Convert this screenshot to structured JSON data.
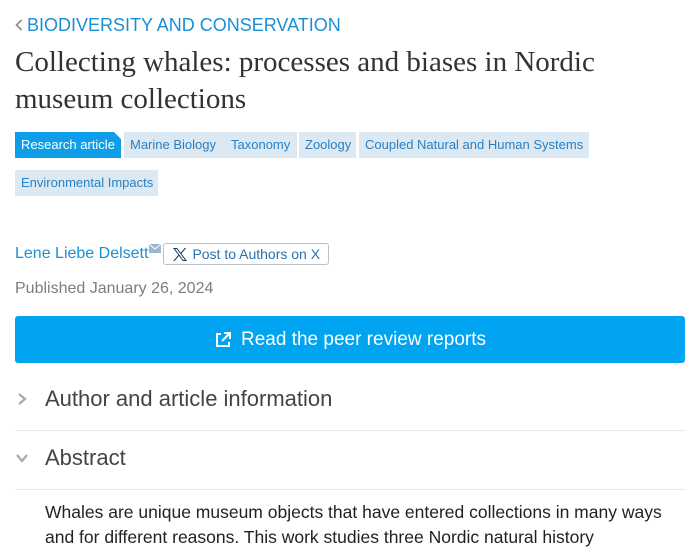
{
  "breadcrumb": {
    "label": "BIODIVERSITY AND CONSERVATION"
  },
  "title": "Collecting whales: processes and biases in Nordic museum collections",
  "tags": [
    "Research article",
    "Marine Biology",
    "Taxonomy",
    "Zoology",
    "Coupled Natural and Human Systems",
    "Environmental Impacts"
  ],
  "author": {
    "name": "Lene Liebe Delsett",
    "share_label": "Post to Authors on X"
  },
  "published": "Published January 26, 2024",
  "review_button": {
    "label": "Read the peer review reports"
  },
  "sections": {
    "author_info": "Author and article information",
    "abstract": "Abstract"
  },
  "abstract_text": "Whales are unique museum objects that have entered collections in many ways and for different reasons. This work studies three Nordic natural history",
  "colors": {
    "link": "#1a8fd6",
    "primary_button": "#00a4f0",
    "tag_bg": "#dde9f2",
    "tag_primary_bg": "#0e9de9"
  }
}
